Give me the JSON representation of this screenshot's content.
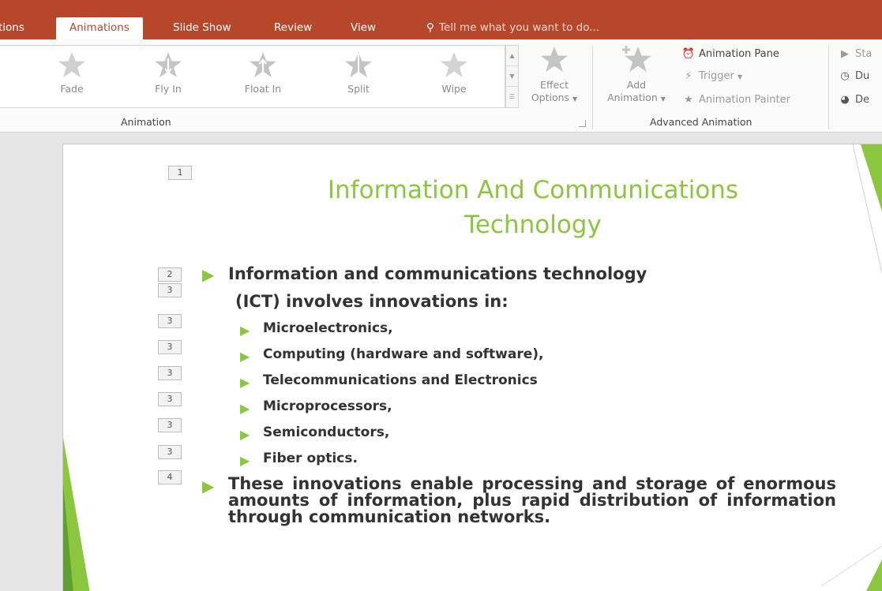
{
  "tabs": [
    {
      "label": "tions",
      "active": false
    },
    {
      "label": "Animations",
      "active": true
    },
    {
      "label": "Slide Show",
      "active": false
    },
    {
      "label": "Review",
      "active": false
    },
    {
      "label": "View",
      "active": false
    }
  ],
  "tell_me": "Tell me what you want to do...",
  "ribbon": {
    "gallery_items": [
      {
        "label": "Fade",
        "icon": "fade-star-icon"
      },
      {
        "label": "Fly In",
        "icon": "fly-in-star-icon"
      },
      {
        "label": "Float In",
        "icon": "float-in-star-icon"
      },
      {
        "label": "Split",
        "icon": "split-star-icon"
      },
      {
        "label": "Wipe",
        "icon": "wipe-star-icon"
      }
    ],
    "effect_options": {
      "line1": "Effect",
      "line2": "Options"
    },
    "add_animation": {
      "line1": "Add",
      "line2": "Animation"
    },
    "animation_pane": "Animation Pane",
    "trigger": "Trigger",
    "animation_painter": "Animation Painter",
    "timing": {
      "start": "Sta",
      "duration": "Du",
      "delay": "De"
    },
    "groups": {
      "animation": "Animation",
      "advanced_animation": "Advanced Animation"
    }
  },
  "slide": {
    "title_line1": "Information And Communications",
    "title_line2": "Technology",
    "tags": [
      "1",
      "2",
      "3",
      "3",
      "3",
      "3",
      "3",
      "3",
      "3",
      "4"
    ],
    "bullet1_line1": "Information and communications technology",
    "bullet1_line2": "(ICT) involves innovations in:",
    "sub_bullets": [
      "Microelectronics,",
      "Computing (hardware and software),",
      "Telecommunications and Electronics",
      "Microprocessors,",
      "Semiconductors,",
      "Fiber optics."
    ],
    "bullet2": "These innovations enable processing and storage of enormous amounts of information, plus rapid distribution of information through communication networks."
  },
  "colors": {
    "ribbon_accent": "#b7472a",
    "slide_title": "#8cc63f",
    "bullet_marker": "#8cc63f",
    "body_text": "#333333"
  }
}
